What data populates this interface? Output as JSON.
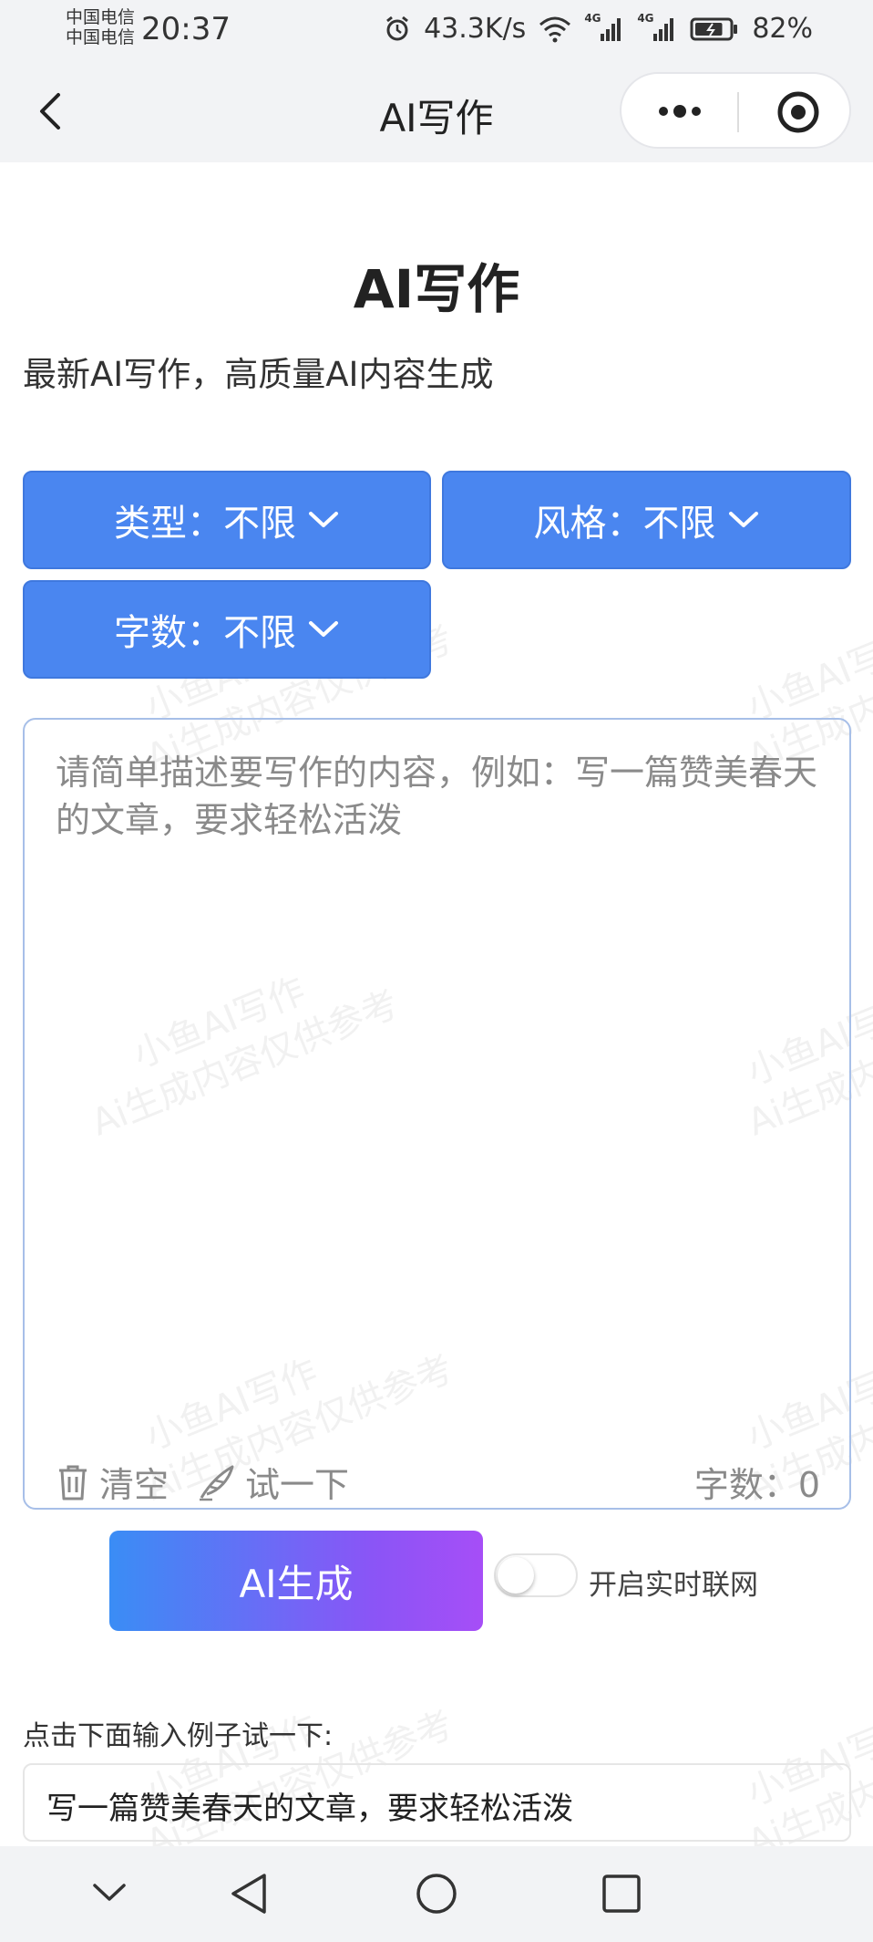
{
  "status_bar": {
    "carrier_1": "中国电信",
    "carrier_2": "中国电信",
    "time": "20:37",
    "network_speed": "43.3K/s",
    "network_1": "4G",
    "network_2": "4G",
    "battery": "82%",
    "battery_level": 0.82
  },
  "nav": {
    "title": "AI写作"
  },
  "header": {
    "title": "AI写作",
    "subtitle": "最新AI写作，高质量AI内容生成"
  },
  "filters": {
    "type": "类型：不限",
    "style": "风格：不限",
    "word_count": "字数：不限"
  },
  "editor": {
    "placeholder": "请简单描述要写作的内容，例如：写一篇赞美春天的文章，要求轻松活泼",
    "clear_label": "清空",
    "try_label": "试一下",
    "count_label": "字数：0"
  },
  "actions": {
    "generate_label": "AI生成",
    "online_label": "开启实时联网",
    "online_enabled": false
  },
  "examples": {
    "hint": "点击下面输入例子试一下:",
    "items": [
      "写一篇赞美春天的文章，要求轻松活泼"
    ]
  },
  "watermark": {
    "line_1": "小鱼AI写作",
    "line_2": "Ai生成内容仅供参考"
  },
  "colors": {
    "accent": "#4a86f0",
    "gradient_start": "#3a8df5",
    "gradient_end": "#a64ef7"
  }
}
